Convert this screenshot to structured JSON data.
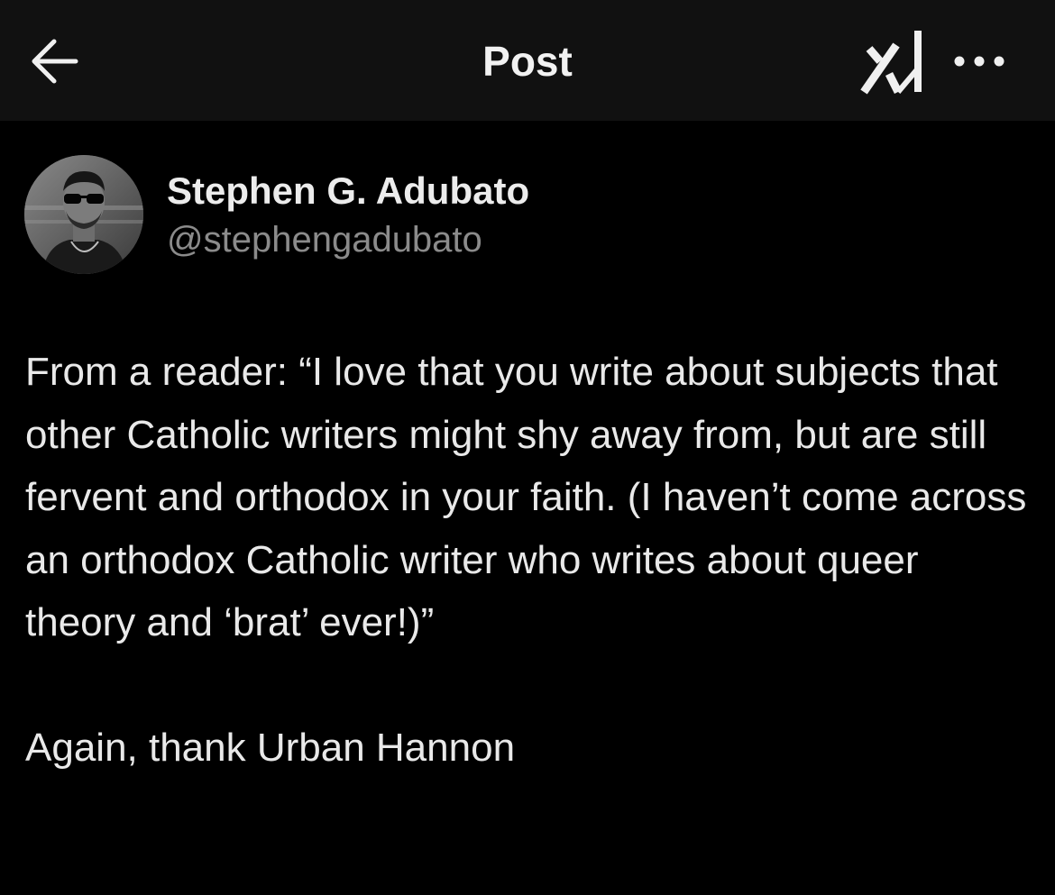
{
  "header": {
    "title": "Post",
    "back_icon": "arrow-left-icon",
    "grok_icon": "grok-logo-icon",
    "more_icon": "more-horizontal-icon"
  },
  "post": {
    "author": {
      "name": "Stephen G. Adubato",
      "handle": "@stephengadubato"
    },
    "text": "From a reader: “I love that you write about subjects that other Catholic writers might shy away from, but are still fervent and orthodox in your faith. (I haven’t come across an orthodox Catholic writer who writes about queer theory and ‘brat’ ever!)”\n\nAgain, thank Urban Hannon"
  },
  "colors": {
    "background": "#000000",
    "header_background": "#111111",
    "primary_text": "#e9e9e9",
    "secondary_text": "#8b8b8b"
  }
}
